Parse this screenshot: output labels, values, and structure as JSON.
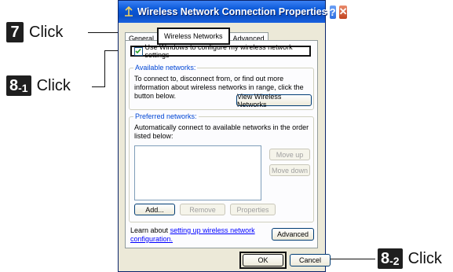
{
  "callouts": [
    {
      "badge": "7",
      "badge_sub": "",
      "text": "Click"
    },
    {
      "badge": "8",
      "badge_sub": "-1",
      "text": "Click"
    },
    {
      "badge": "8",
      "badge_sub": "-2",
      "text": "Click"
    }
  ],
  "window": {
    "title": "Wireless Network Connection Properties",
    "help_label": "?",
    "close_label": "✕",
    "tabs": [
      "General",
      "Wireless Networks",
      "Advanced"
    ],
    "active_tab": "Wireless Networks",
    "use_windows_checkbox": {
      "label": "Use Windows to configure my wireless network settings",
      "checked": true
    },
    "available": {
      "label": "Available networks:",
      "text": "To connect to, disconnect from, or find out more information about wireless networks in range, click the button below.",
      "button": "View Wireless Networks"
    },
    "preferred": {
      "label": "Preferred networks:",
      "text": "Automatically connect to available networks in the order listed below:",
      "move_up": "Move up",
      "move_down": "Move down",
      "add": "Add...",
      "remove": "Remove",
      "properties": "Properties"
    },
    "learn_text": "Learn about",
    "learn_link": "setting up wireless network configuration.",
    "advanced_button": "Advanced",
    "ok": "OK",
    "cancel": "Cancel"
  },
  "colors": {
    "title_bar": "#0b4fc6",
    "dialog_bg": "#ece9d8",
    "panel_bg": "#fcfcfe",
    "group_label": "#0046d5",
    "link": "#0000ff"
  }
}
